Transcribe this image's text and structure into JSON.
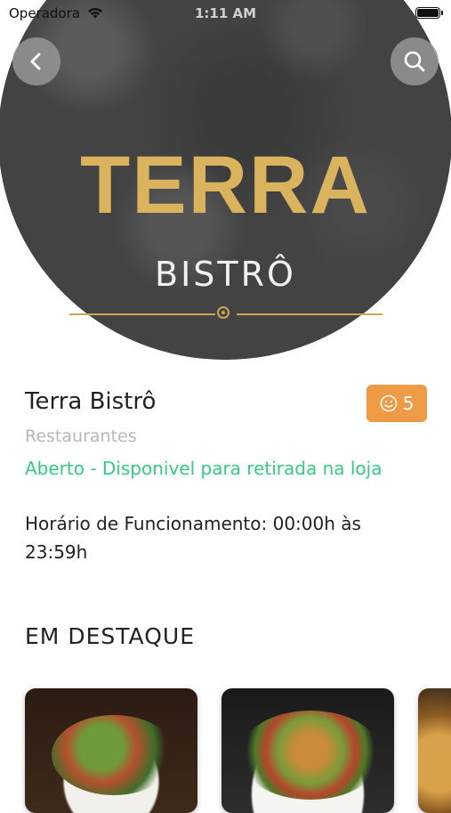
{
  "status_bar": {
    "carrier": "Operadora",
    "time": "1:11 AM"
  },
  "hero": {
    "logo_title": "TERRA",
    "logo_subtitle": "BISTRÔ"
  },
  "nav": {
    "back_icon": "chevron-left-icon",
    "search_icon": "search-icon"
  },
  "restaurant": {
    "name": "Terra Bistrô",
    "category": "Restaurantes",
    "status": "Aberto - Disponivel para retirada na loja",
    "hours": "Horário de Funcionamento: 00:00h às 23:59h",
    "rating_icon": "smiley-icon",
    "rating_count": "5"
  },
  "featured": {
    "title": "EM DESTAQUE",
    "items": [
      {
        "image": "salad-dish"
      },
      {
        "image": "shrimp-salad-dish"
      },
      {
        "image": "baked-dish"
      }
    ]
  },
  "colors": {
    "accent": "#ef9a45",
    "open_status": "#33cc80",
    "logo_gold": "#d9b35d"
  }
}
